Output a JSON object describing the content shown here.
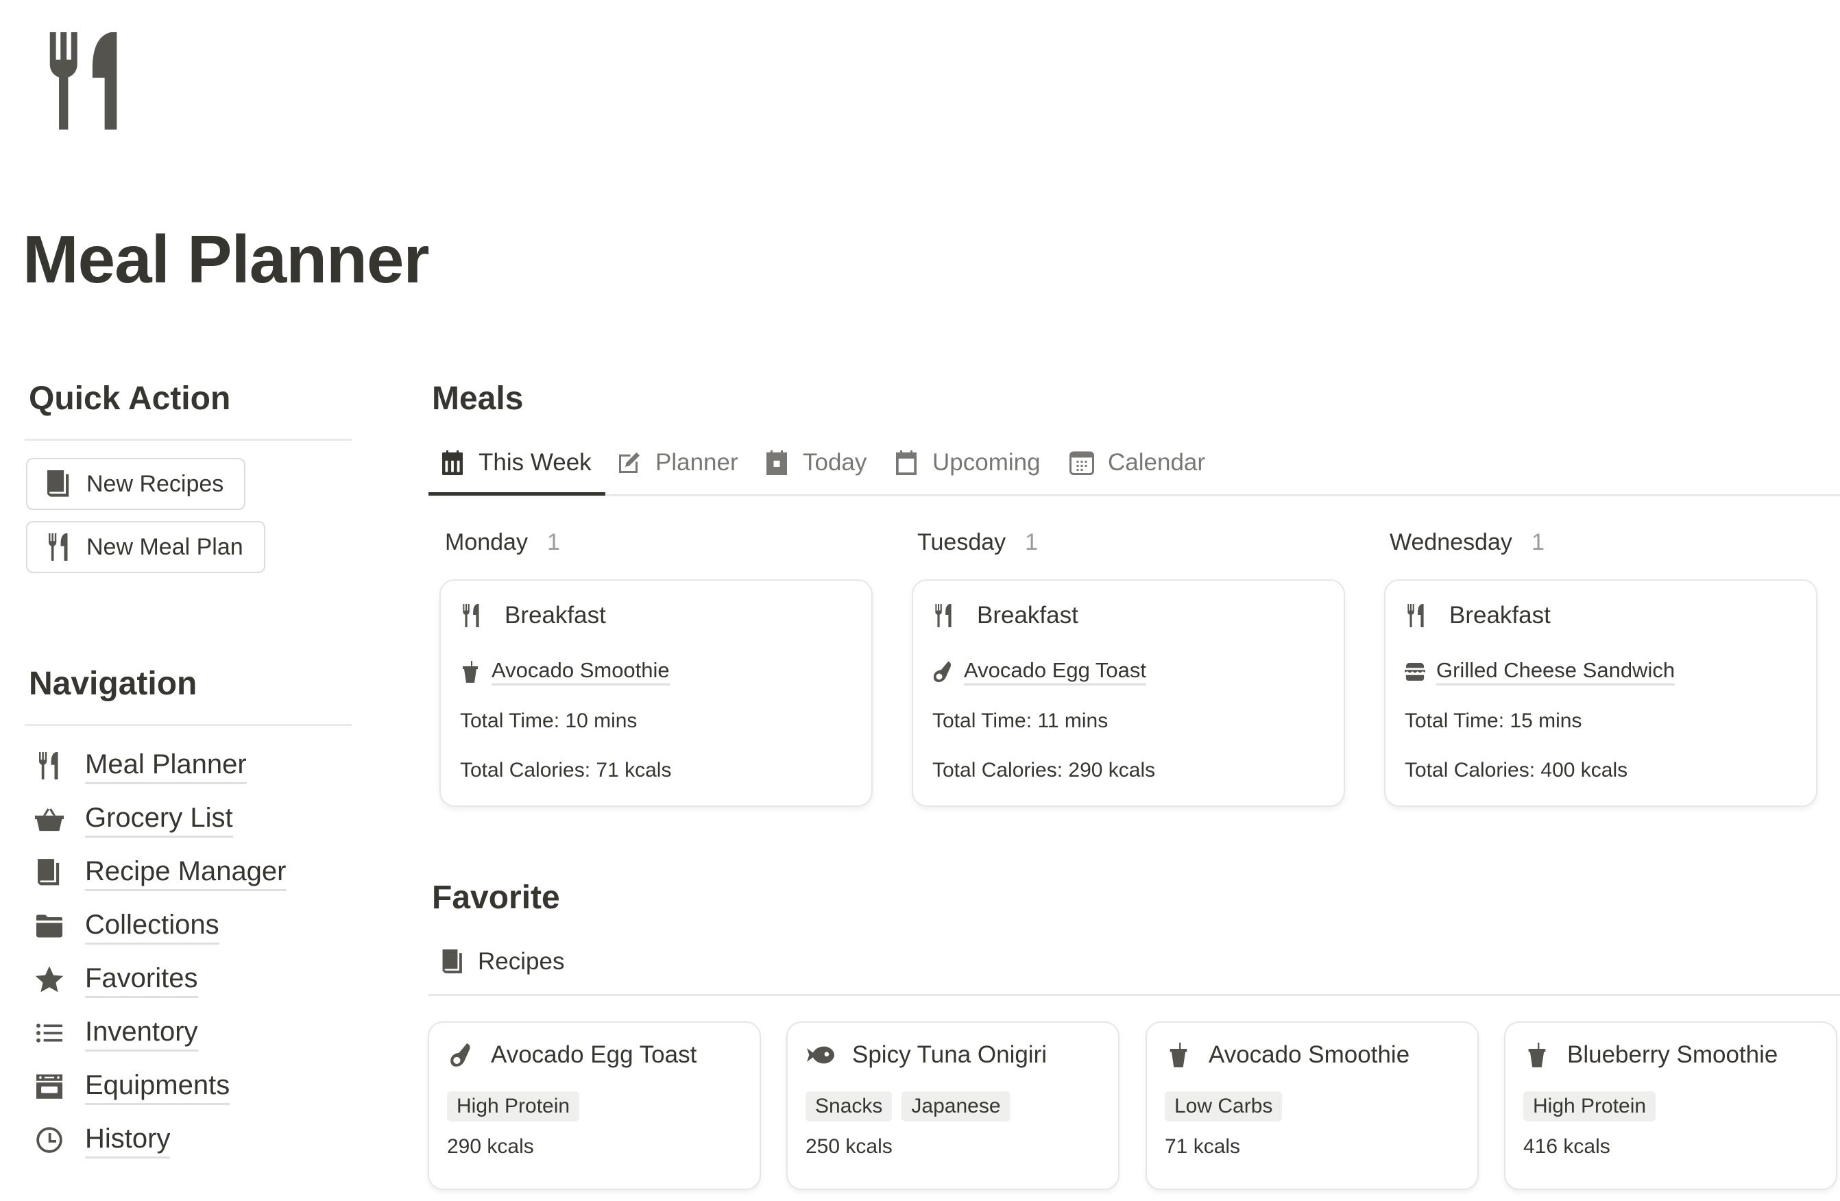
{
  "page": {
    "icon": "fork-knife-icon",
    "title": "Meal Planner"
  },
  "colors": {
    "text": "#37352f",
    "muted_text": "#787774",
    "count_text": "#9b9a97",
    "icon": "#55534e",
    "divider": "#e9e9e7",
    "tag_bg": "#efefee",
    "card_border": "#e6e6e4"
  },
  "quick_action": {
    "heading": "Quick Action",
    "buttons": [
      {
        "label": "New Recipes",
        "icon": "book-icon"
      },
      {
        "label": "New Meal Plan",
        "icon": "fork-knife-icon"
      }
    ]
  },
  "navigation": {
    "heading": "Navigation",
    "items": [
      {
        "label": "Meal Planner",
        "icon": "fork-knife-icon"
      },
      {
        "label": "Grocery List",
        "icon": "basket-icon"
      },
      {
        "label": "Recipe Manager",
        "icon": "book-icon"
      },
      {
        "label": "Collections",
        "icon": "folder-icon"
      },
      {
        "label": "Favorites",
        "icon": "star-icon"
      },
      {
        "label": "Inventory",
        "icon": "list-icon"
      },
      {
        "label": "Equipments",
        "icon": "oven-icon"
      },
      {
        "label": "History",
        "icon": "clock-icon"
      }
    ]
  },
  "meals": {
    "heading": "Meals",
    "tabs": [
      {
        "label": "This Week",
        "icon": "calendar-week-icon",
        "active": true
      },
      {
        "label": "Planner",
        "icon": "edit-icon",
        "active": false
      },
      {
        "label": "Today",
        "icon": "calendar-day-icon",
        "active": false
      },
      {
        "label": "Upcoming",
        "icon": "calendar-icon",
        "active": false
      },
      {
        "label": "Calendar",
        "icon": "calendar-grid-icon",
        "active": false
      }
    ],
    "days": [
      {
        "name": "Monday",
        "count": "1",
        "cards": [
          {
            "meal_type": "Breakfast",
            "recipe": "Avocado Smoothie",
            "recipe_icon": "drink-icon",
            "total_time": "Total Time: 10 mins",
            "total_calories": "Total Calories: 71 kcals"
          }
        ]
      },
      {
        "name": "Tuesday",
        "count": "1",
        "cards": [
          {
            "meal_type": "Breakfast",
            "recipe": "Avocado Egg Toast",
            "recipe_icon": "avocado-icon",
            "total_time": "Total Time: 11 mins",
            "total_calories": "Total Calories: 290 kcals"
          }
        ]
      },
      {
        "name": "Wednesday",
        "count": "1",
        "cards": [
          {
            "meal_type": "Breakfast",
            "recipe": "Grilled Cheese Sandwich",
            "recipe_icon": "sandwich-icon",
            "total_time": "Total Time: 15 mins",
            "total_calories": "Total Calories: 400 kcals"
          }
        ]
      }
    ]
  },
  "favorite": {
    "heading": "Favorite",
    "tab": {
      "label": "Recipes",
      "icon": "book-icon"
    },
    "recipes": [
      {
        "name": "Avocado Egg Toast",
        "icon": "avocado-icon",
        "tags": [
          "High Protein"
        ],
        "kcal": "290 kcals"
      },
      {
        "name": "Spicy Tuna Onigiri",
        "icon": "fish-icon",
        "tags": [
          "Snacks",
          "Japanese"
        ],
        "kcal": "250 kcals"
      },
      {
        "name": "Avocado Smoothie",
        "icon": "drink-icon",
        "tags": [
          "Low Carbs"
        ],
        "kcal": "71 kcals"
      },
      {
        "name": "Blueberry Smoothie",
        "icon": "drink-icon",
        "tags": [
          "High Protein"
        ],
        "kcal": "416 kcals"
      }
    ]
  }
}
